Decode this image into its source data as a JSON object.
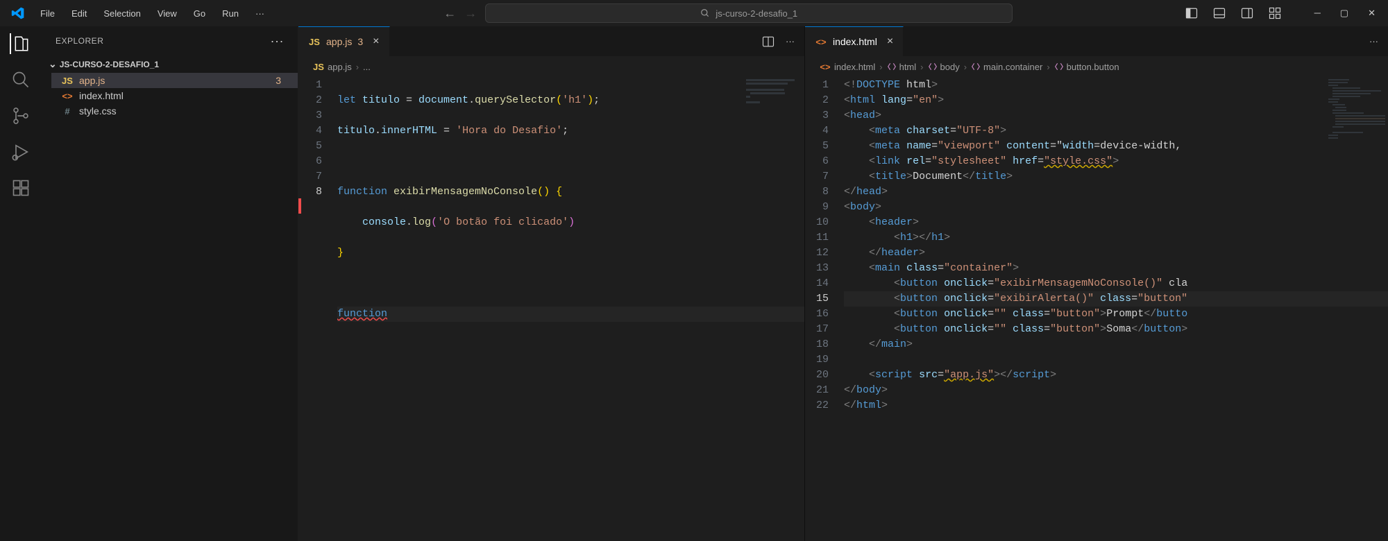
{
  "menubar": [
    "File",
    "Edit",
    "Selection",
    "View",
    "Go",
    "Run"
  ],
  "search_placeholder": "js-curso-2-desafio_1",
  "explorer": {
    "title": "EXPLORER",
    "folder": "JS-CURSO-2-DESAFIO_1",
    "files": [
      {
        "name": "app.js",
        "icon": "JS",
        "badge": "3",
        "active": true
      },
      {
        "name": "index.html",
        "icon": "<>",
        "badge": "",
        "active": false
      },
      {
        "name": "style.css",
        "icon": "#",
        "badge": "",
        "active": false
      }
    ]
  },
  "editor_left": {
    "tab": {
      "icon": "JS",
      "name": "app.js",
      "badge": "3"
    },
    "breadcrumb": [
      "app.js",
      "..."
    ],
    "lines": [
      1,
      2,
      3,
      4,
      5,
      6,
      7,
      8
    ],
    "current_line": 8,
    "code": {
      "l1": {
        "a": "let",
        "b": " titulo ",
        "c": "=",
        "d": " document",
        "e": ".",
        "f": "querySelector",
        "g": "(",
        "h": "'h1'",
        "i": ")",
        "j": ";"
      },
      "l2": {
        "a": "titulo",
        "b": ".",
        "c": "innerHTML",
        "d": " = ",
        "e": "'Hora do Desafio'",
        "f": ";"
      },
      "l4": {
        "a": "function",
        "b": " ",
        "c": "exibirMensagemNoConsole",
        "d": "()",
        "e": " {",
        "open": "{"
      },
      "l5": {
        "a": "    console",
        "b": ".",
        "c": "log",
        "d": "(",
        "e": "'O botão foi clicado'",
        "f": ")"
      },
      "l6": {
        "a": "}"
      },
      "l8": {
        "a": "function"
      }
    }
  },
  "editor_right": {
    "tab": {
      "icon": "<>",
      "name": "index.html"
    },
    "breadcrumb": [
      "index.html",
      "html",
      "body",
      "main.container",
      "button.button"
    ],
    "lines": [
      1,
      2,
      3,
      4,
      5,
      6,
      7,
      8,
      9,
      10,
      11,
      12,
      13,
      14,
      15,
      16,
      17,
      18,
      19,
      20,
      21,
      22
    ],
    "current_line": 15,
    "code": {
      "l1": "<!DOCTYPE html>",
      "l2": "<html lang=\"en\">",
      "l3": "<head>",
      "l4": "    <meta charset=\"UTF-8\">",
      "l5": "    <meta name=\"viewport\" content=\"width=device-width, ",
      "l6": "    <link rel=\"stylesheet\" href=\"style.css\">",
      "l7": "    <title>Document</title>",
      "l8": "</head>",
      "l9": "<body>",
      "l10": "    <header>",
      "l11": "        <h1></h1>",
      "l12": "    </header>",
      "l13": "    <main class=\"container\">",
      "l14": "        <button onclick=\"exibirMensagemNoConsole()\" cla",
      "l15": "        <button onclick=\"exibirAlerta()\" class=\"button\"",
      "l16": "        <button onclick=\"\" class=\"button\">Prompt</butto",
      "l17": "        <button onclick=\"\" class=\"button\">Soma</button>",
      "l18": "    </main>",
      "l19": "",
      "l20": "    <script src=\"app.js\"></script>",
      "l21": "</body>",
      "l22": "</html>"
    }
  }
}
